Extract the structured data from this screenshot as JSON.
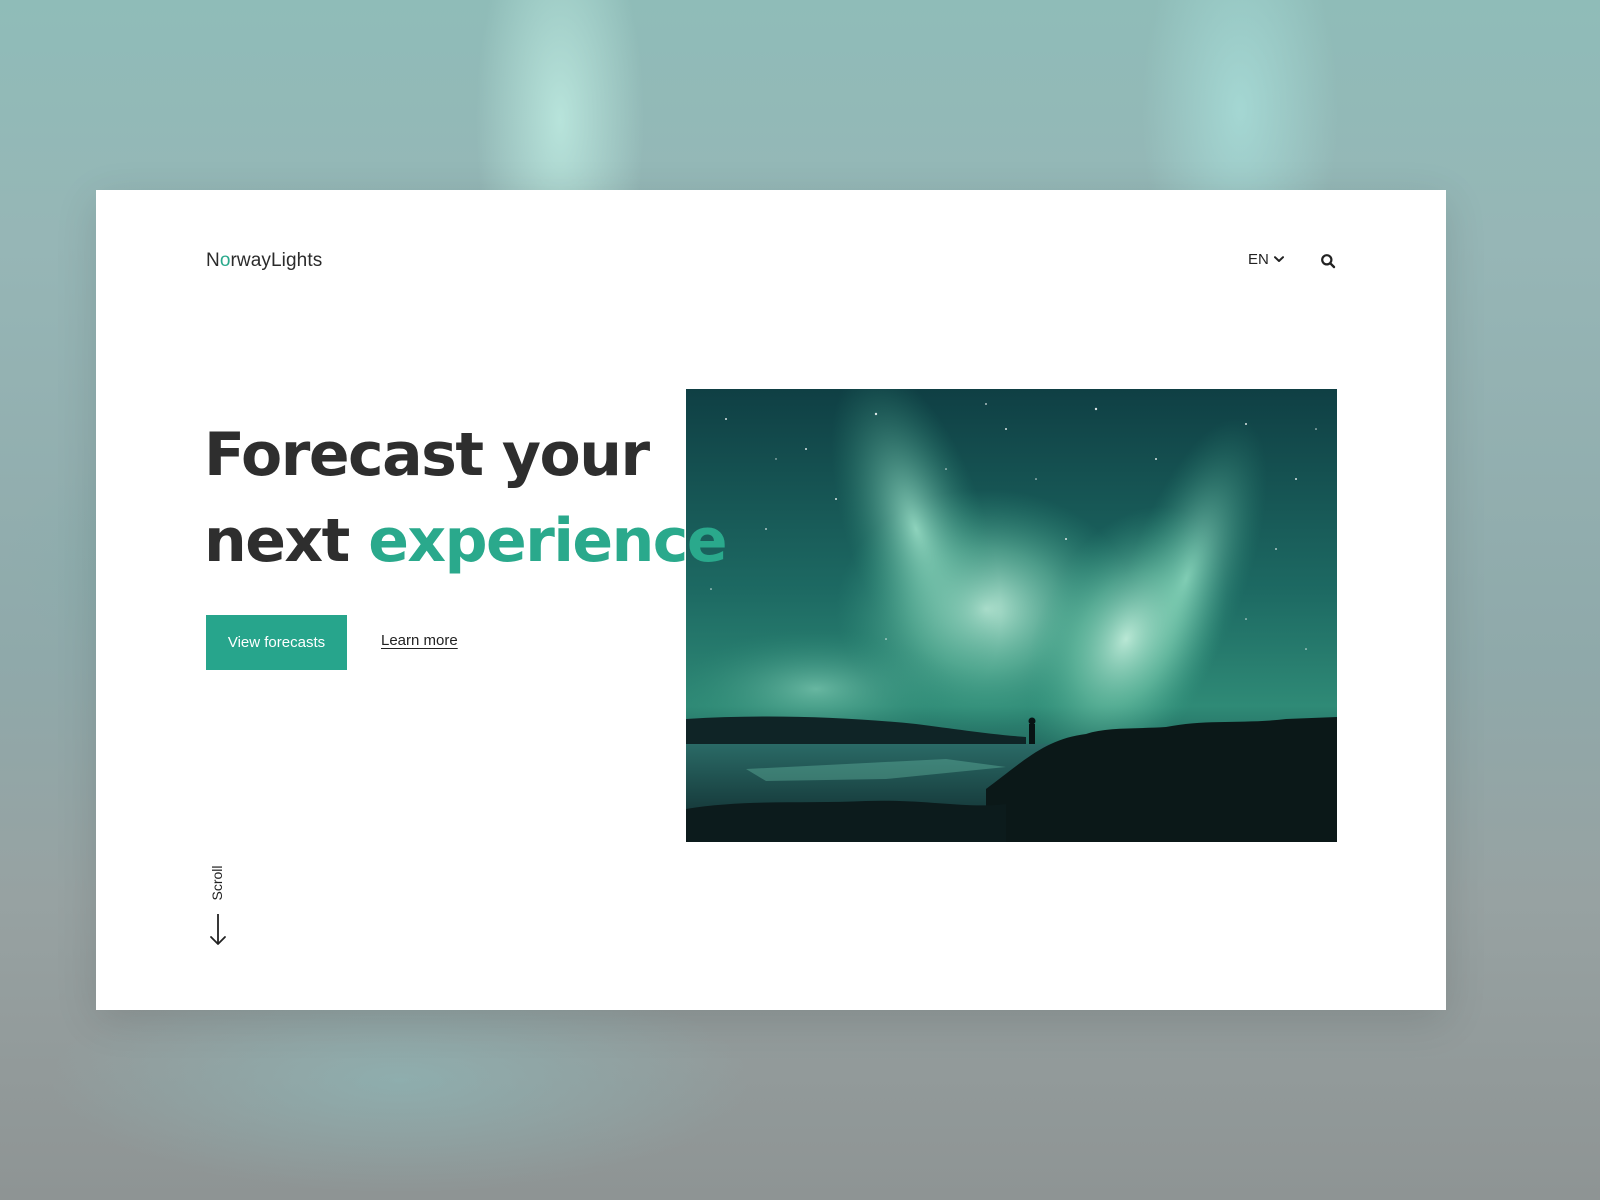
{
  "logo": {
    "prefix": "N",
    "accent": "o",
    "suffix": "rwayLights"
  },
  "nav": {
    "language": "EN"
  },
  "hero": {
    "headline_line1": "Forecast your",
    "headline_word2": "next",
    "headline_accent": "experience",
    "primary_button": "View forecasts",
    "secondary_link": "Learn more",
    "image_alt": "Northern lights over a lake with a lone figure on the shore"
  },
  "scroll": {
    "label": "Scroll"
  },
  "icons": {
    "language_dropdown": "chevron-down-icon",
    "search": "search-icon",
    "scroll": "arrow-down-icon"
  },
  "colors": {
    "accent": "#2aa98c",
    "button": "#27a58c",
    "text": "#2e2e2e"
  }
}
